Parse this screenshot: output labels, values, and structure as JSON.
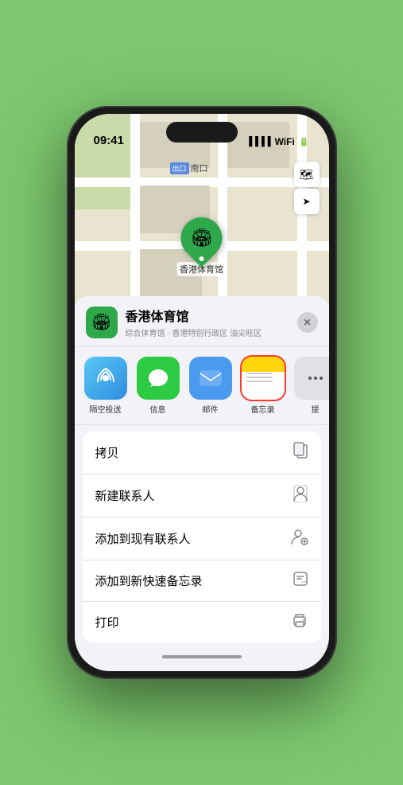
{
  "status": {
    "time": "09:41",
    "signal_icon": "📶",
    "wifi_icon": "📡",
    "battery_icon": "🔋"
  },
  "map": {
    "label_tag": "出口",
    "label_text": "南口",
    "layer_icon": "🗺",
    "location_icon": "➤",
    "marker_emoji": "🏟",
    "marker_label": "香港体育馆"
  },
  "place": {
    "name": "香港体育馆",
    "subtitle": "综合体育馆 · 香港特别行政区 油尖旺区",
    "icon_emoji": "🏟"
  },
  "share_items": [
    {
      "id": "airdrop",
      "label": "隔空投送",
      "type": "airdrop"
    },
    {
      "id": "messages",
      "label": "信息",
      "type": "messages"
    },
    {
      "id": "mail",
      "label": "邮件",
      "type": "mail"
    },
    {
      "id": "notes",
      "label": "备忘录",
      "type": "notes"
    },
    {
      "id": "more",
      "label": "提",
      "type": "more"
    }
  ],
  "actions": [
    {
      "id": "copy",
      "label": "拷贝",
      "icon": "copy"
    },
    {
      "id": "new-contact",
      "label": "新建联系人",
      "icon": "person"
    },
    {
      "id": "add-contact",
      "label": "添加到现有联系人",
      "icon": "person-add"
    },
    {
      "id": "quick-note",
      "label": "添加到新快速备忘录",
      "icon": "note"
    },
    {
      "id": "print",
      "label": "打印",
      "icon": "print"
    }
  ],
  "close_label": "✕"
}
